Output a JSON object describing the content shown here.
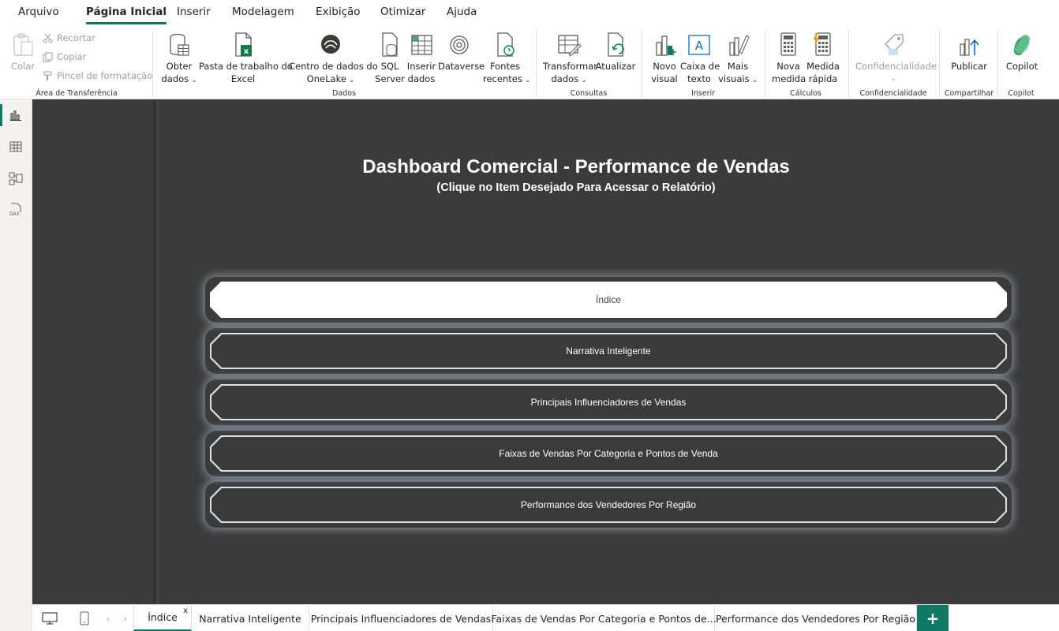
{
  "menu": {
    "tabs": [
      {
        "label": "Arquivo"
      },
      {
        "label": "Página Inicial"
      },
      {
        "label": "Inserir"
      },
      {
        "label": "Modelagem"
      },
      {
        "label": "Exibição"
      },
      {
        "label": "Otimizar"
      },
      {
        "label": "Ajuda"
      }
    ],
    "active": "Página Inicial"
  },
  "ribbon": {
    "clipboard": {
      "paste": "Colar",
      "cut": "Recortar",
      "copy": "Copiar",
      "format_painter": "Pincel de formatação",
      "group": "Área de Transferência"
    },
    "data": {
      "get_data_1": "Obter",
      "get_data_2": "dados",
      "excel_1": "Pasta de trabalho do",
      "excel_2": "Excel",
      "onelake_1": "Centro de dados do",
      "onelake_2": "OneLake",
      "sql_1": "SQL",
      "sql_2": "Server",
      "enter_1": "Inserir",
      "enter_2": "dados",
      "dataverse": "Dataverse",
      "recent_1": "Fontes",
      "recent_2": "recentes",
      "group": "Dados"
    },
    "queries": {
      "transform_1": "Transformar",
      "transform_2": "dados",
      "refresh": "Atualizar",
      "group": "Consultas"
    },
    "insert": {
      "new_visual_1": "Novo",
      "new_visual_2": "visual",
      "textbox_1": "Caixa de",
      "textbox_2": "texto",
      "more_visuals_1": "Mais",
      "more_visuals_2": "visuais",
      "group": "Inserir"
    },
    "calc": {
      "new_measure_1": "Nova",
      "new_measure_2": "medida",
      "quick_measure_1": "Medida",
      "quick_measure_2": "rápida",
      "group": "Cálculos"
    },
    "sensitivity": {
      "label": "Confidencialidade",
      "group": "Confidencialidade"
    },
    "share": {
      "publish": "Publicar",
      "group": "Compartilhar"
    },
    "copilot": {
      "label": "Copilot",
      "group": "Copilot"
    }
  },
  "report": {
    "title": "Dashboard Comercial - Performance de Vendas",
    "subtitle": "(Clique no Item Desejado Para Acessar o Relatório)",
    "buttons": [
      {
        "label": "Índice",
        "selected": true
      },
      {
        "label": "Narrativa Inteligente",
        "selected": false
      },
      {
        "label": "Principais Influenciadores de Vendas",
        "selected": false
      },
      {
        "label": "Faixas de Vendas Por Categoria e Pontos de Venda",
        "selected": false
      },
      {
        "label": "Performance dos Vendedores Por Região",
        "selected": false
      }
    ]
  },
  "page_tabs": [
    {
      "label": "Índice",
      "active": true
    },
    {
      "label": "Narrativa Inteligente"
    },
    {
      "label": "Principais Influenciadores de Vendas"
    },
    {
      "label": "Faixas de Vendas Por Categoria e Pontos de..."
    },
    {
      "label": "Performance dos Vendedores Por Região"
    }
  ],
  "page_tabs_close": "x",
  "page_tabs_add": "+",
  "colors": {
    "accent": "#117865",
    "canvas": "#3a3a3a",
    "button_border": "#d9e3ec"
  }
}
